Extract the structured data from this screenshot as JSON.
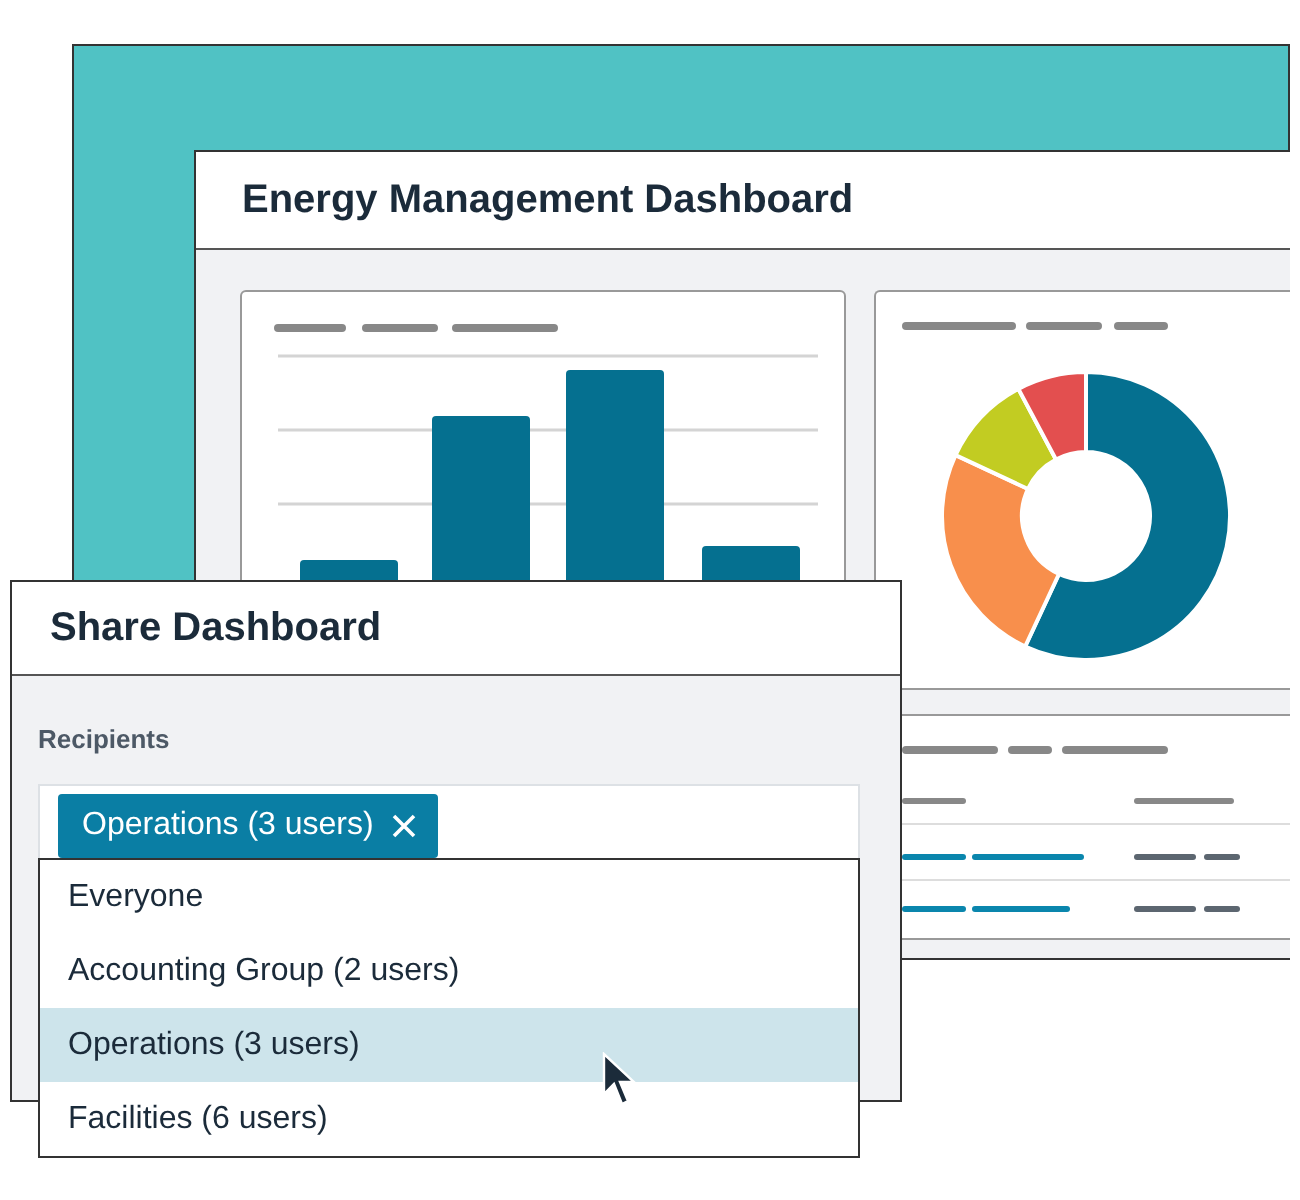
{
  "dashboard": {
    "title": "Energy Management Dashboard"
  },
  "share_dialog": {
    "title": "Share Dashboard",
    "recipients_label": "Recipients",
    "recipient_chips": [
      {
        "label": "Operations (3 users)"
      }
    ],
    "options": [
      {
        "label": "Everyone",
        "selected": false
      },
      {
        "label": "Accounting Group (2 users)",
        "selected": false
      },
      {
        "label": "Operations (3 users)",
        "selected": true
      },
      {
        "label": "Facilities (6 users)",
        "selected": false
      }
    ]
  }
}
